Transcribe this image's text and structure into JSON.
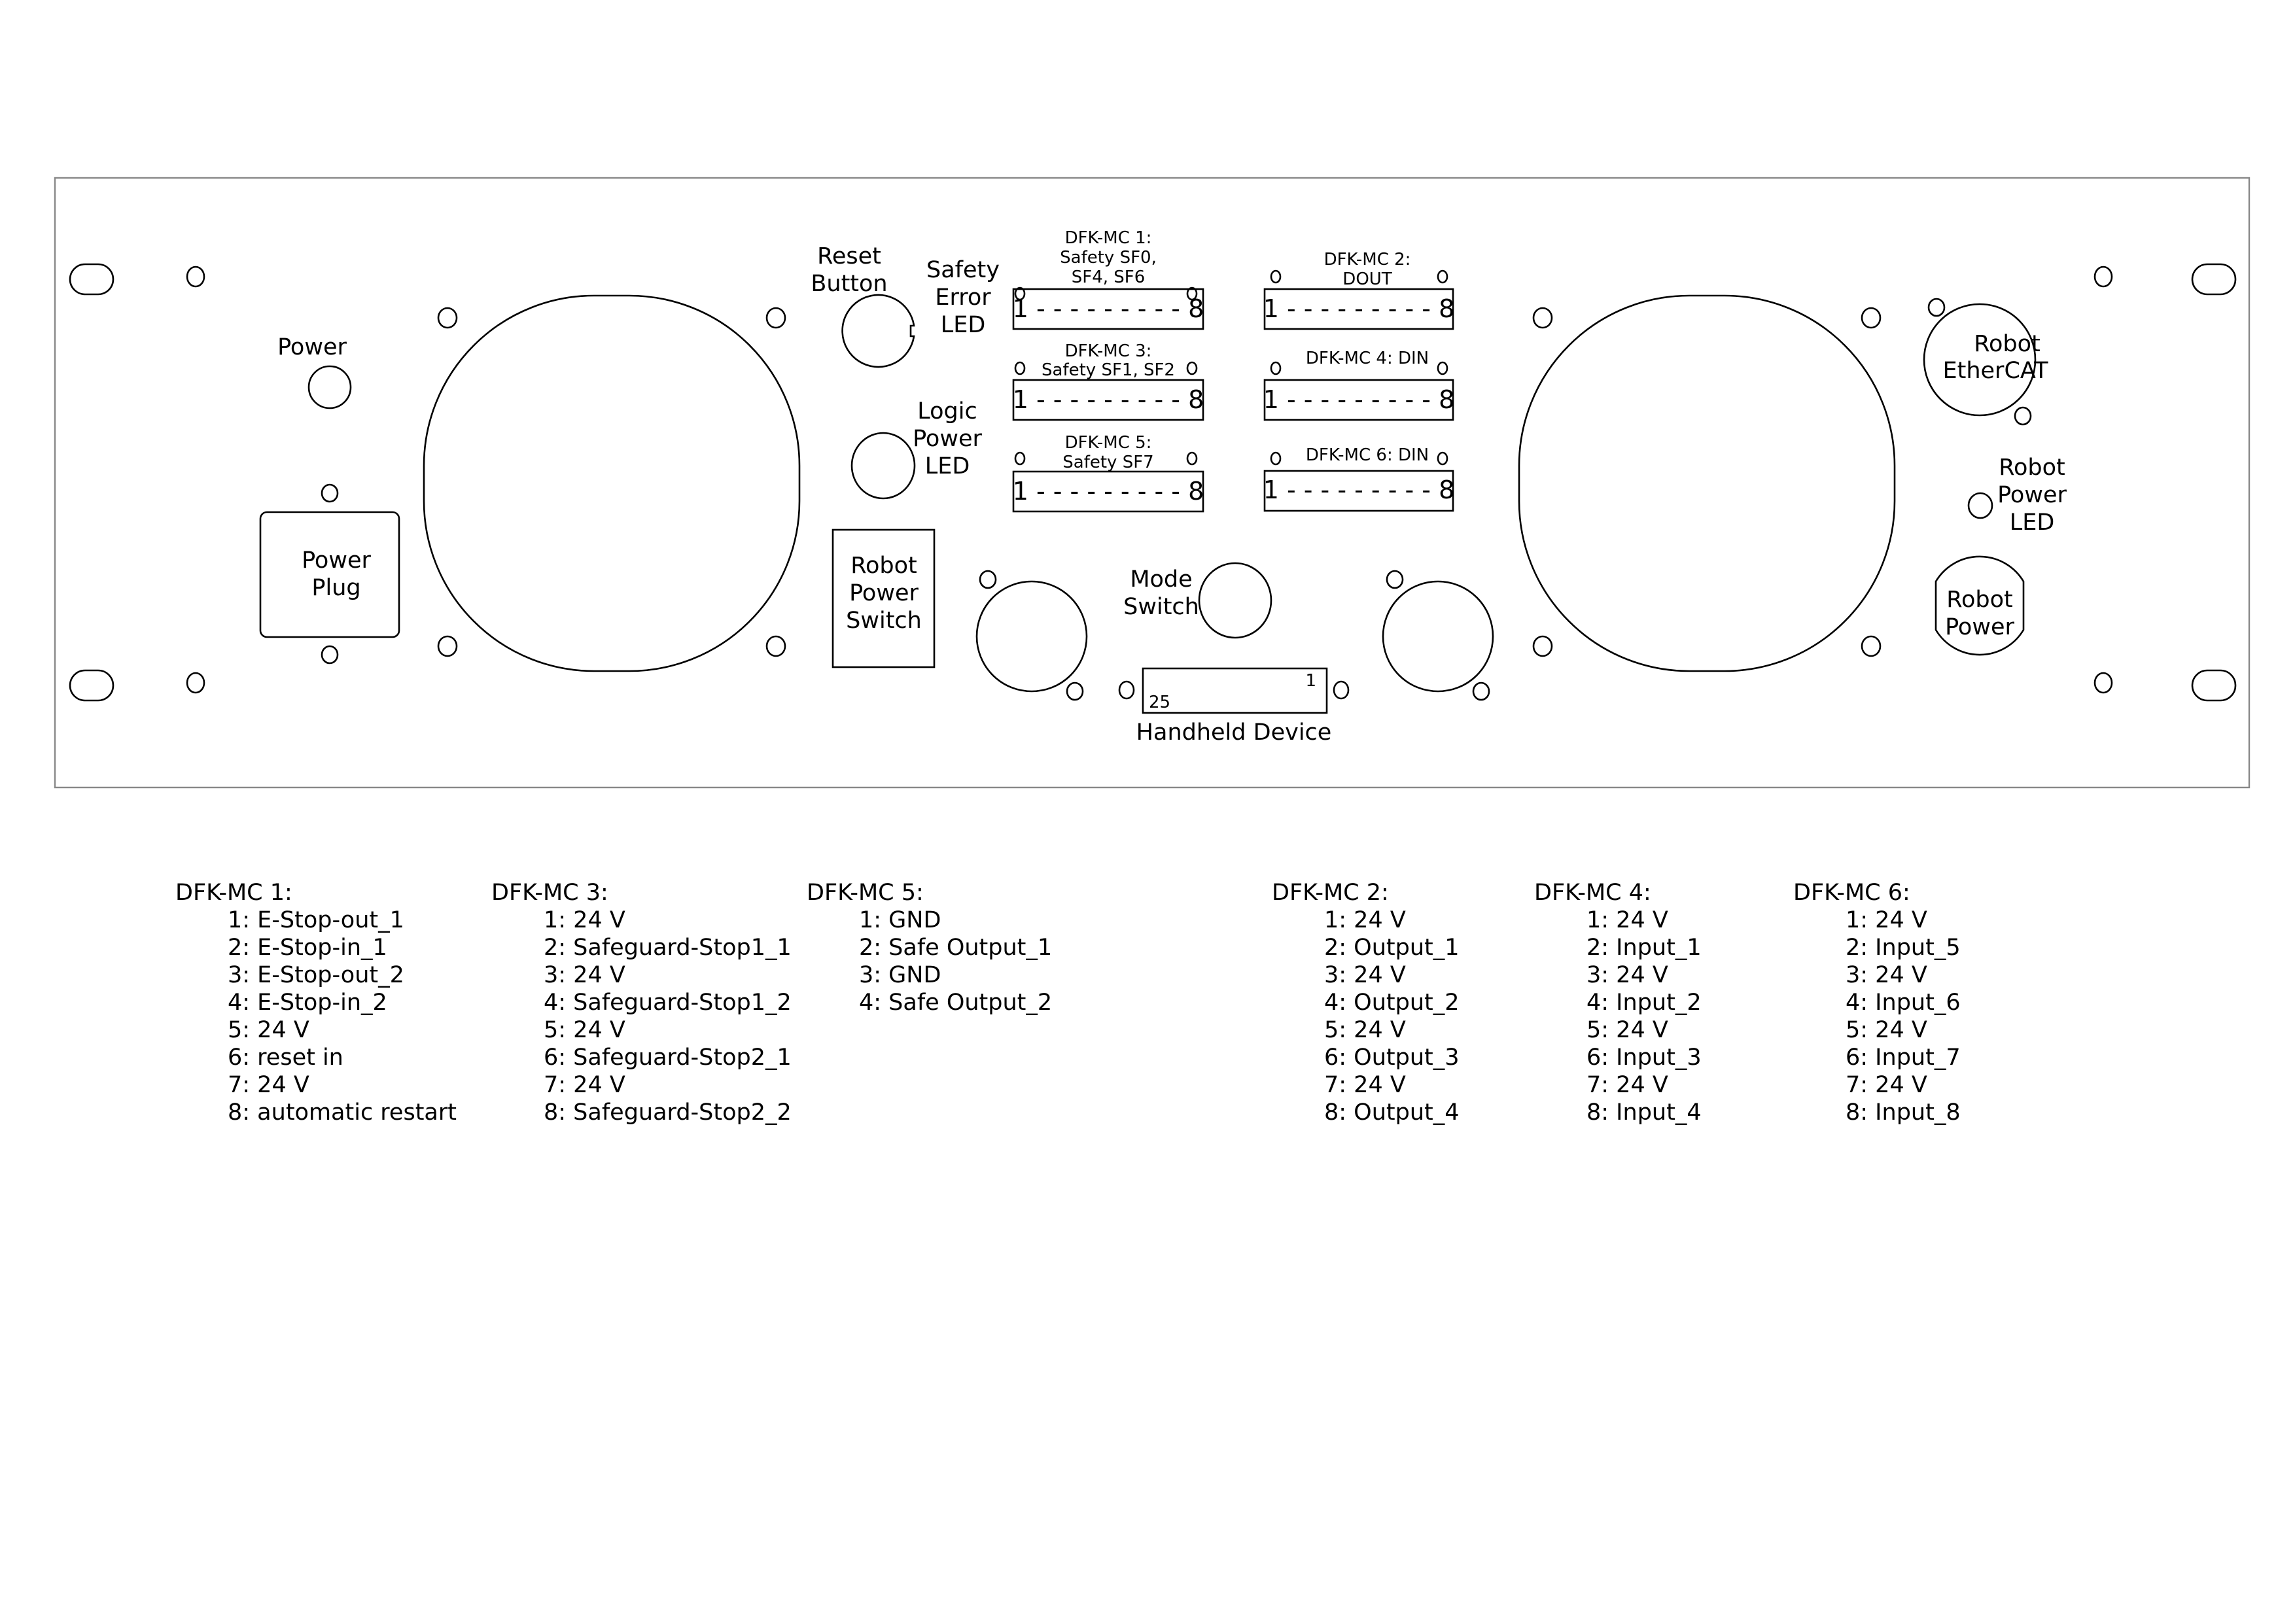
{
  "panel": {
    "labels": {
      "power": "Power",
      "power_plug": [
        "Power",
        "Plug"
      ],
      "reset_button": [
        "Reset",
        "Button"
      ],
      "safety_error_led": [
        "Safety",
        "Error",
        "LED"
      ],
      "logic_power_led": [
        "Logic",
        "Power",
        "LED"
      ],
      "robot_power_switch": [
        "Robot",
        "Power",
        "Switch"
      ],
      "mode_switch": [
        "Mode",
        "Switch"
      ],
      "handheld_device": "Handheld Device",
      "handheld_pin_first": "1",
      "handheld_pin_last": "25",
      "robot_ethercat": [
        "Robot",
        "EtherCAT"
      ],
      "robot_power_led": [
        "Robot",
        "Power",
        "LED"
      ],
      "robot_power": [
        "Robot",
        "Power"
      ]
    },
    "connectors": [
      {
        "id": "dfk-mc-1",
        "title": [
          "DFK-MC 1:",
          "Safety SF0,",
          "SF4, SF6"
        ],
        "pins": "1 - - - - - - - - - 8"
      },
      {
        "id": "dfk-mc-2",
        "title": [
          "DFK-MC 2:",
          "DOUT"
        ],
        "pins": "1 - - - - - - - - - 8"
      },
      {
        "id": "dfk-mc-3",
        "title": [
          "DFK-MC 3:",
          "Safety SF1, SF2"
        ],
        "pins": "1 - - - - - - - - - 8"
      },
      {
        "id": "dfk-mc-4",
        "title": [
          "DFK-MC 4: DIN"
        ],
        "pins": "1 - - - - - - - - - 8"
      },
      {
        "id": "dfk-mc-5",
        "title": [
          "DFK-MC 5:",
          "Safety SF7"
        ],
        "pins": "1 - - - - - - - - - 8"
      },
      {
        "id": "dfk-mc-6",
        "title": [
          "DFK-MC 6: DIN"
        ],
        "pins": "1 - - - - - - - - - 8"
      }
    ]
  },
  "legend": [
    {
      "title": "DFK-MC 1:",
      "pins": [
        "1: E-Stop-out_1",
        "2: E-Stop-in_1",
        "3: E-Stop-out_2",
        "4: E-Stop-in_2",
        "5: 24 V",
        "6: reset in",
        "7: 24 V",
        "8: automatic restart"
      ]
    },
    {
      "title": "DFK-MC 3:",
      "pins": [
        "1: 24 V",
        "2: Safeguard-Stop1_1",
        "3: 24 V",
        "4: Safeguard-Stop1_2",
        "5: 24 V",
        "6: Safeguard-Stop2_1",
        "7: 24 V",
        "8: Safeguard-Stop2_2"
      ]
    },
    {
      "title": "DFK-MC 5:",
      "pins": [
        "1: GND",
        "2: Safe Output_1",
        "3: GND",
        "4: Safe Output_2"
      ]
    },
    {
      "title": "DFK-MC 2:",
      "pins": [
        "1: 24 V",
        "2: Output_1",
        "3: 24 V",
        "4: Output_2",
        "5: 24 V",
        "6: Output_3",
        "7: 24 V",
        "8: Output_4"
      ]
    },
    {
      "title": "DFK-MC 4:",
      "pins": [
        "1: 24 V",
        "2: Input_1",
        "3: 24 V",
        "4: Input_2",
        "5: 24 V",
        "6: Input_3",
        "7: 24 V",
        "8: Input_4"
      ]
    },
    {
      "title": "DFK-MC 6:",
      "pins": [
        "1: 24 V",
        "2: Input_5",
        "3: 24 V",
        "4: Input_6",
        "5: 24 V",
        "6: Input_7",
        "7: 24 V",
        "8: Input_8"
      ]
    }
  ]
}
